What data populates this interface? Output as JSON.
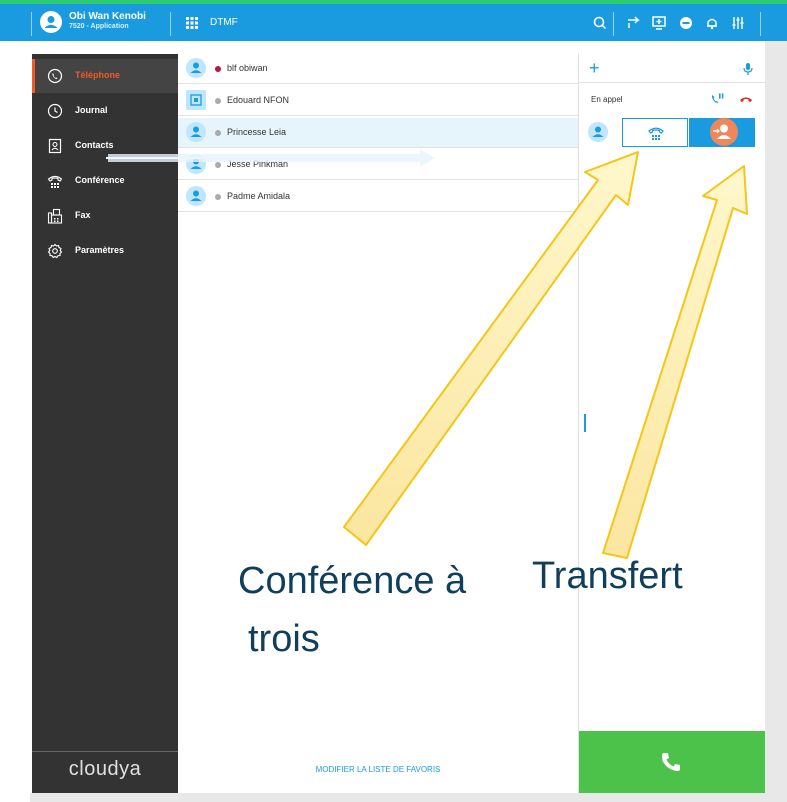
{
  "topbar": {
    "user_name": "Obi Wan Kenobi",
    "user_sub": "7520 - Application",
    "dtmf_label": "DTMF",
    "icons": [
      "search-icon",
      "call-forward-icon",
      "screen-share-icon",
      "dnd-icon",
      "bell-icon",
      "settings-sliders-icon"
    ]
  },
  "sidebar": {
    "items": [
      {
        "label": "Téléphone",
        "icon": "phone-icon",
        "active": true
      },
      {
        "label": "Journal",
        "icon": "clock-icon",
        "active": false
      },
      {
        "label": "Contacts",
        "icon": "contacts-icon",
        "active": false
      },
      {
        "label": "Conférence",
        "icon": "conference-phone-icon",
        "active": false
      },
      {
        "label": "Fax",
        "icon": "fax-icon",
        "active": false
      },
      {
        "label": "Paramètres",
        "icon": "gear-icon",
        "active": false
      }
    ],
    "logo": "cloudya"
  },
  "favorites": {
    "items": [
      {
        "name": "blf obiwan",
        "status_color": "#b8163a",
        "avatar": "person"
      },
      {
        "name": "Edouard NFON",
        "status_color": "#aaaaaa",
        "avatar": "square"
      },
      {
        "name": "Princesse Leia",
        "status_color": "#aaaaaa",
        "avatar": "person"
      },
      {
        "name": "Jesse Pinkman",
        "status_color": "#aaaaaa",
        "avatar": "person"
      },
      {
        "name": "Padme Amidala",
        "status_color": "#aaaaaa",
        "avatar": "person"
      }
    ],
    "footer_link": "MODIFIER LA LISTE DE FAVORIS"
  },
  "call_panel": {
    "status": "En appel",
    "colors": {
      "accent": "#1a9be0",
      "hangup": "#e0261f",
      "call": "#4cc24a",
      "highlight": "#f0875a"
    }
  },
  "annotations": {
    "conference_line1": "Conférence à",
    "conference_line2": "trois",
    "transfer": "Transfert"
  }
}
